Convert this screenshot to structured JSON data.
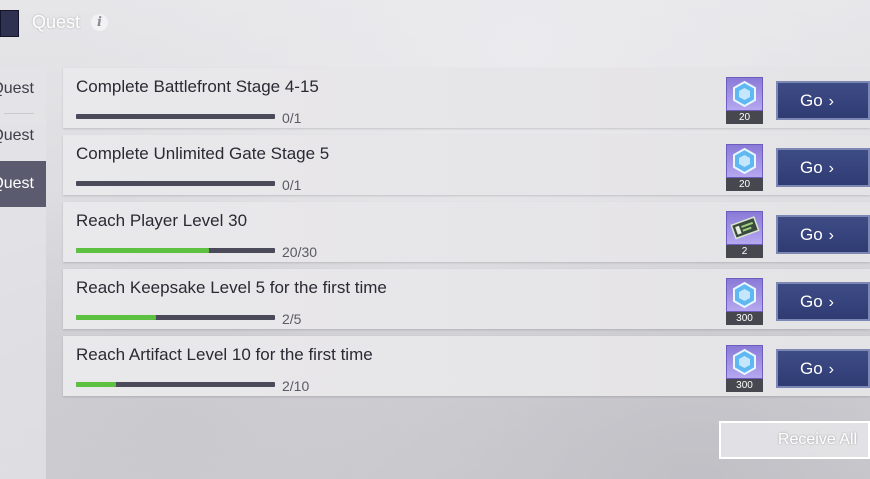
{
  "header": {
    "title": "Quest",
    "info_icon": "info-icon"
  },
  "sidebar": {
    "items": [
      {
        "label": "Quest"
      },
      {
        "label": "Quest"
      },
      {
        "label": "Quest",
        "active": true
      }
    ]
  },
  "quests": [
    {
      "title": "Complete Battlefront Stage 4-15",
      "progress": "0/1",
      "fraction": 0,
      "reward_icon": "crystal-icon",
      "reward_count": "20",
      "button": "Go"
    },
    {
      "title": "Complete Unlimited Gate Stage 5",
      "progress": "0/1",
      "fraction": 0,
      "reward_icon": "crystal-icon",
      "reward_count": "20",
      "button": "Go"
    },
    {
      "title": "Reach Player Level 30",
      "progress": "20/30",
      "fraction": 0.6667,
      "reward_icon": "ticket-icon",
      "reward_count": "2",
      "button": "Go"
    },
    {
      "title": "Reach Keepsake Level 5 for the first time",
      "progress": "2/5",
      "fraction": 0.4,
      "reward_icon": "crystal-icon",
      "reward_count": "300",
      "button": "Go"
    },
    {
      "title": "Reach Artifact Level 10 for the first time",
      "progress": "2/10",
      "fraction": 0.2,
      "reward_icon": "crystal-icon",
      "reward_count": "300",
      "button": "Go"
    }
  ],
  "footer": {
    "receive_all": "Receive All"
  },
  "colors": {
    "progress_fill": "#5dc040",
    "progress_track": "#4a4a5a",
    "go_button": "#34407a",
    "reward_bg": "#9c8ce3"
  }
}
